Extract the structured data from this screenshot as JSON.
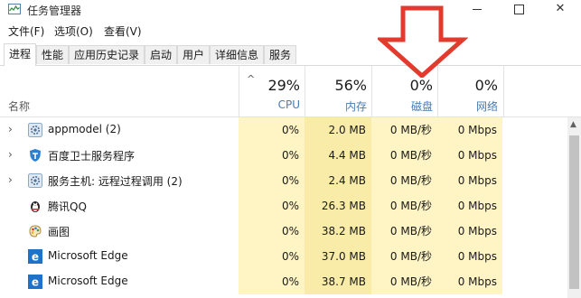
{
  "window": {
    "title": "任务管理器",
    "controls": {
      "minimize": "minimize",
      "maximize": "maximize",
      "close": "✕"
    }
  },
  "menu": [
    "文件(F)",
    "选项(O)",
    "查看(V)"
  ],
  "tabs": [
    "进程",
    "性能",
    "应用历史记录",
    "启动",
    "用户",
    "详细信息",
    "服务"
  ],
  "active_tab": "进程",
  "columns": {
    "name": "名称",
    "cpu": {
      "label": "CPU",
      "total": "29%"
    },
    "memory": {
      "label": "内存",
      "total": "56%"
    },
    "disk": {
      "label": "磁盘",
      "total": "0%"
    },
    "network": {
      "label": "网络",
      "total": "0%"
    }
  },
  "processes": [
    {
      "name": "appmodel (2)",
      "icon": "gear-icon",
      "expandable": true,
      "cpu": "0%",
      "memory": "2.0 MB",
      "disk": "0 MB/秒",
      "network": "0 Mbps"
    },
    {
      "name": "百度卫士服务程序",
      "icon": "shield-icon",
      "expandable": true,
      "cpu": "0%",
      "memory": "4.4 MB",
      "disk": "0 MB/秒",
      "network": "0 Mbps"
    },
    {
      "name": "服务主机: 远程过程调用 (2)",
      "icon": "gear-icon",
      "expandable": true,
      "cpu": "0%",
      "memory": "2.4 MB",
      "disk": "0 MB/秒",
      "network": "0 Mbps"
    },
    {
      "name": "腾讯QQ",
      "icon": "penguin-icon",
      "expandable": false,
      "cpu": "0%",
      "memory": "26.3 MB",
      "disk": "0 MB/秒",
      "network": "0 Mbps"
    },
    {
      "name": "画图",
      "icon": "paint-icon",
      "expandable": false,
      "cpu": "0%",
      "memory": "38.2 MB",
      "disk": "0 MB/秒",
      "network": "0 Mbps"
    },
    {
      "name": "Microsoft Edge",
      "icon": "edge-icon",
      "expandable": false,
      "cpu": "0%",
      "memory": "37.0 MB",
      "disk": "0 MB/秒",
      "network": "0 Mbps"
    },
    {
      "name": "Microsoft Edge",
      "icon": "edge-icon",
      "expandable": false,
      "cpu": "0%",
      "memory": "38.7 MB",
      "disk": "0 MB/秒",
      "network": "0 Mbps"
    }
  ],
  "colors": {
    "cpu_cell": "#fff4c4",
    "memory_cell": "#f9eca8",
    "header_label": "#4a7bb0",
    "annotation_arrow": "#e23a2c"
  }
}
